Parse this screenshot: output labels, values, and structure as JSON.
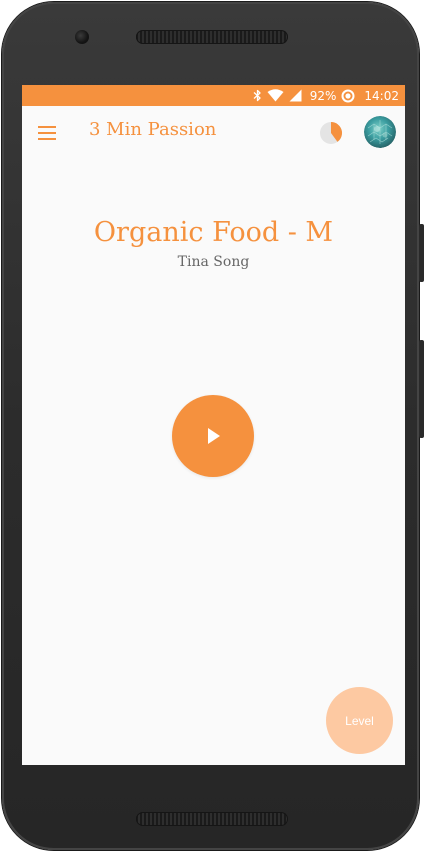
{
  "status_bar": {
    "battery": "92%",
    "time": "14:02",
    "icons": [
      "bluetooth-icon",
      "wifi-icon",
      "signal-icon",
      "battery-icon"
    ]
  },
  "toolbar": {
    "title": "3 Min Passion",
    "menu_icon": "hamburger-menu-icon",
    "progress_icon": "pie-progress-icon",
    "progress_fraction": 0.4,
    "avatar": "profile-avatar"
  },
  "player": {
    "title": "Organic Food - M",
    "artist": "Tina Song",
    "play_icon": "play-icon"
  },
  "level_button": {
    "label": "Level"
  },
  "colors": {
    "accent": "#f5913e",
    "accent_light": "#fdc9a2",
    "background": "#fafafa",
    "artist_text": "#666666"
  }
}
